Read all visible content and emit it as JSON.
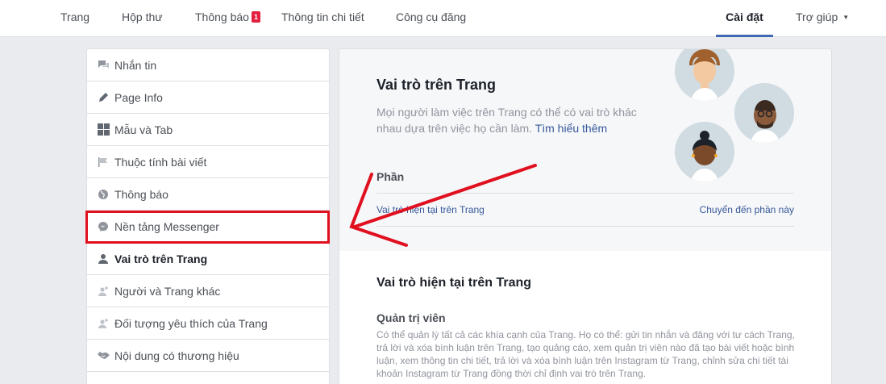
{
  "topnav": {
    "items": [
      "Trang",
      "Hộp thư",
      "Thông báo",
      "Thông tin chi tiết",
      "Công cụ đăng"
    ],
    "notification_badge": "1",
    "settings": "Cài đặt",
    "help": "Trợ giúp"
  },
  "sidebar": {
    "items": [
      {
        "label": "Nhắn tin",
        "icon": "chat-icon"
      },
      {
        "label": "Page Info",
        "icon": "pencil-icon"
      },
      {
        "label": "Mẫu và Tab",
        "icon": "grid-icon"
      },
      {
        "label": "Thuộc tính bài viết",
        "icon": "flag-icon"
      },
      {
        "label": "Thông báo",
        "icon": "globe-icon"
      },
      {
        "label": "Nền tảng Messenger",
        "icon": "messenger-icon"
      },
      {
        "label": "Vai trò trên Trang",
        "icon": "person-icon"
      },
      {
        "label": "Người và Trang khác",
        "icon": "person-add-icon"
      },
      {
        "label": "Đối tượng yêu thích của Trang",
        "icon": "person-add-icon"
      },
      {
        "label": "Nội dung có thương hiệu",
        "icon": "handshake-icon"
      }
    ]
  },
  "main": {
    "hero_title": "Vai trò trên Trang",
    "hero_desc": "Mọi người làm việc trên Trang có thể có vai trò khác nhau dựa trên việc họ cần làm.",
    "learn_more": "Tìm hiểu thêm",
    "section_label": "Phần",
    "section_link": "Vai trò hiện tại trên Trang",
    "section_go": "Chuyển đến phần này",
    "body_title": "Vai trò hiện tại trên Trang",
    "admin_title": "Quản trị viên",
    "admin_desc": "Có thể quản lý tất cả các khía cạnh của Trang. Họ có thể: gửi tin nhắn và đăng với tư cách Trang, trả lời và xóa bình luận trên Trang, tạo quảng cáo, xem quản trị viên nào đã tạo bài viết hoặc bình luận, xem thông tin chi tiết, trả lời và xóa bình luận trên Instagram từ Trang, chỉnh sửa chi tiết tài khoản Instagram từ Trang đồng thời chỉ định vai trò trên Trang."
  },
  "colors": {
    "accent": "#4267b2",
    "link": "#365899",
    "highlight": "#e0101f",
    "badge": "#e41e3f"
  }
}
